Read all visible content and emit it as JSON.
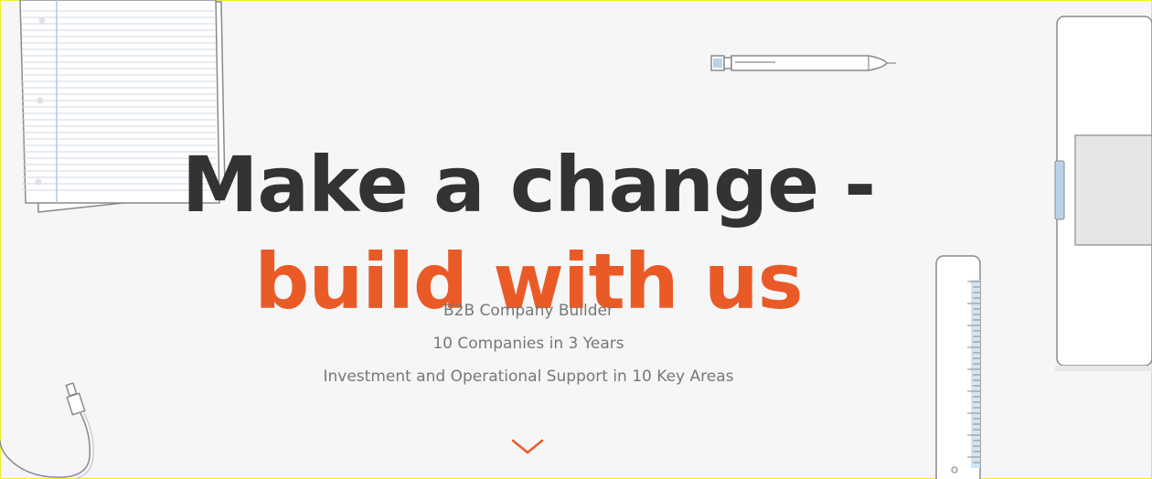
{
  "hero": {
    "headline_line1": "Make a change -",
    "headline_line2": "build with us",
    "subtitle_lines": [
      "B2B Company Builder",
      "10 Companies in 3 Years",
      "Investment and Operational Support in 10 Key Areas"
    ]
  },
  "colors": {
    "background": "#f6f6f6",
    "headline": "#333333",
    "accent": "#ea5a27",
    "subtitle": "#777777",
    "illustration_stroke": "#8a8a8a",
    "illustration_blue": "#b9d3ea"
  },
  "icons": {
    "scroll_down": "chevron-down-icon"
  }
}
